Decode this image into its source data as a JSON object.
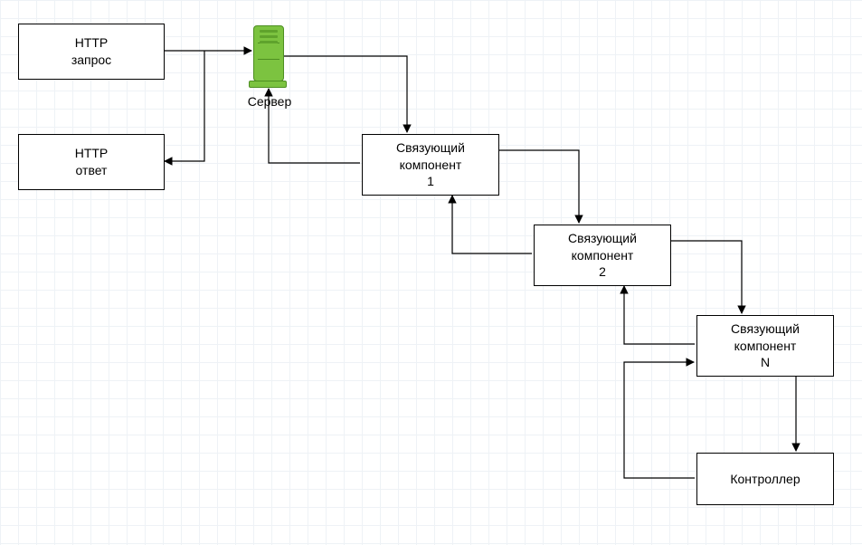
{
  "nodes": {
    "http_request": "HTTP\nзапрос",
    "http_response": "HTTP\nответ",
    "server_label": "Сервер",
    "middleware1": "Связующий\nкомпонент\n1",
    "middleware2": "Связующий\nкомпонент\n2",
    "middlewareN": "Связующий\nкомпонент\nN",
    "controller": "Контроллер"
  }
}
